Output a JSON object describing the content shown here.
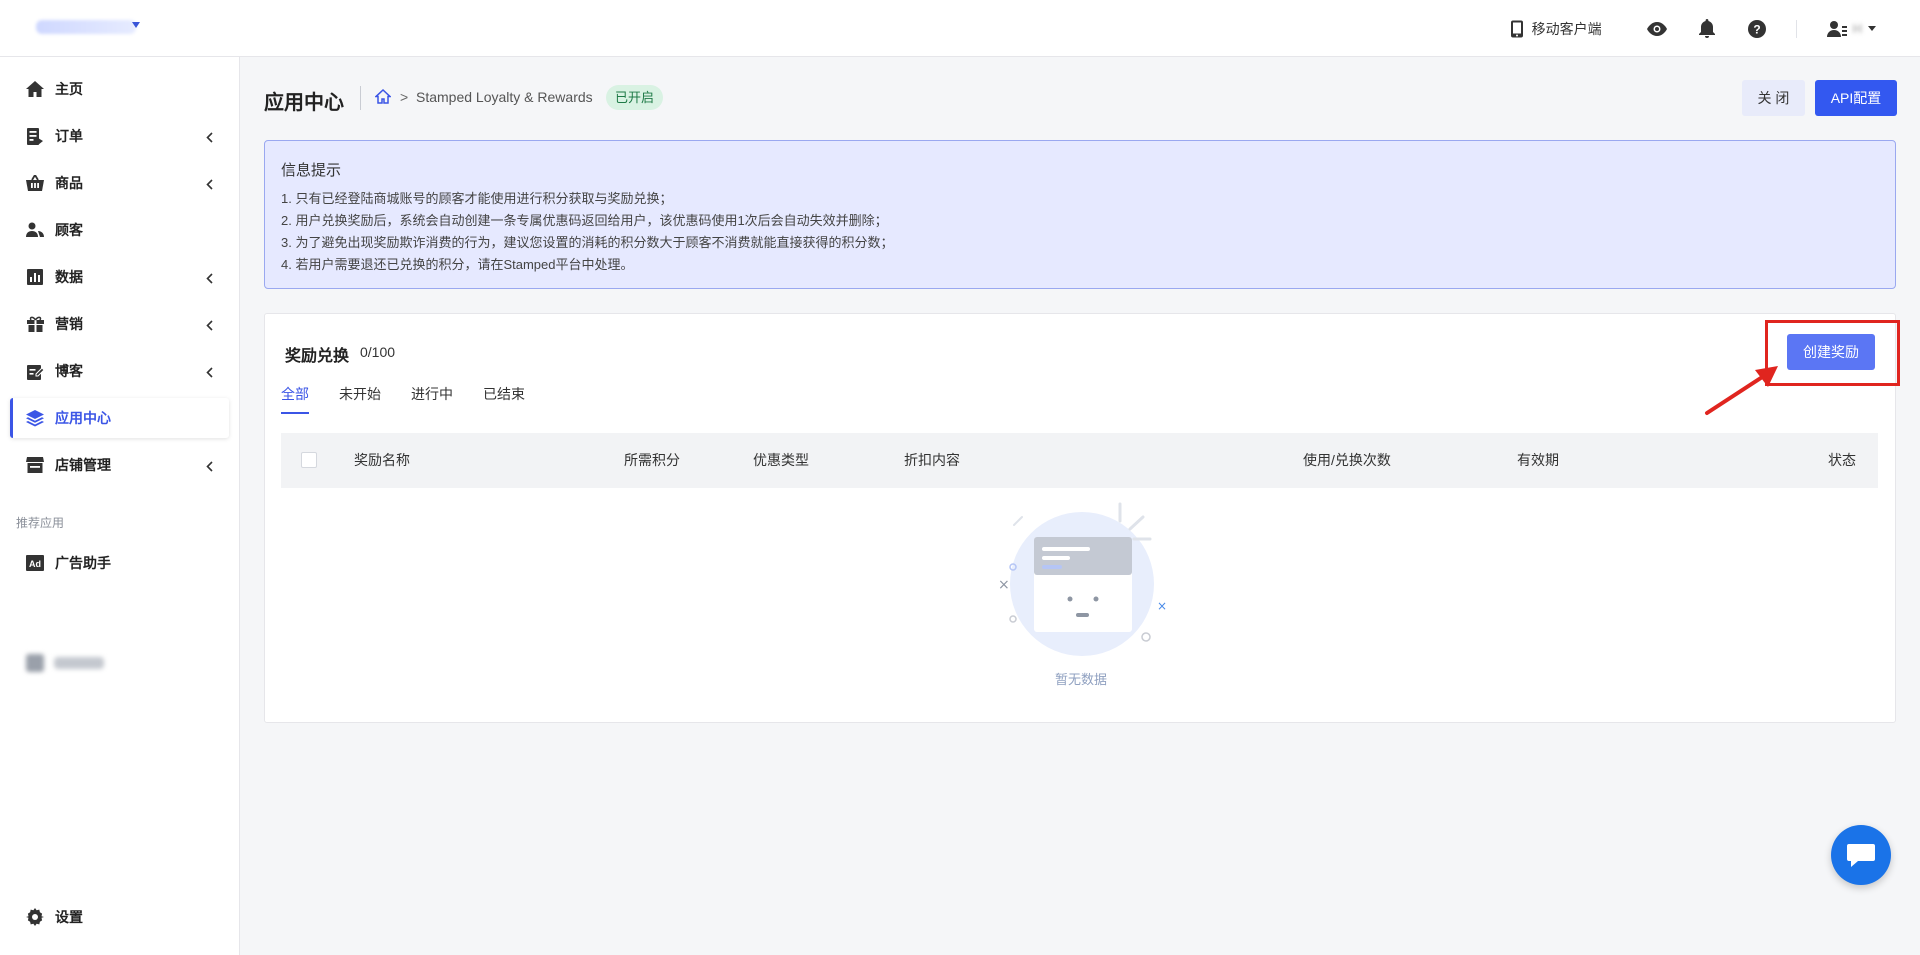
{
  "topbar": {
    "mobile_client": "移动客户端",
    "user_name": "H"
  },
  "sidebar": {
    "items": [
      {
        "label": "主页",
        "icon": "home-icon"
      },
      {
        "label": "订单",
        "icon": "order-icon"
      },
      {
        "label": "商品",
        "icon": "basket-icon"
      },
      {
        "label": "顾客",
        "icon": "customers-icon"
      },
      {
        "label": "数据",
        "icon": "chart-icon"
      },
      {
        "label": "营销",
        "icon": "gift-icon"
      },
      {
        "label": "博客",
        "icon": "edit-icon"
      },
      {
        "label": "应用中心",
        "icon": "layers-icon"
      },
      {
        "label": "店铺管理",
        "icon": "store-icon"
      }
    ],
    "recommended_label": "推荐应用",
    "recommended": [
      {
        "label": "广告助手",
        "icon": "ad-icon"
      }
    ],
    "settings_label": "设置"
  },
  "header": {
    "title": "应用中心",
    "breadcrumb_separator": ">",
    "breadcrumb_app": "Stamped Loyalty & Rewards",
    "status": "已开启",
    "close_button": "关 闭",
    "api_button": "API配置"
  },
  "info": {
    "title": "信息提示",
    "lines": [
      "1. 只有已经登陆商城账号的顾客才能使用进行积分获取与奖励兑换；",
      "2. 用户兑换奖励后，系统会自动创建一条专属优惠码返回给用户，该优惠码使用1次后会自动失效并删除；",
      "3. 为了避免出现奖励欺诈消费的行为，建议您设置的消耗的积分数大于顾客不消费就能直接获得的积分数；",
      "4. 若用户需要退还已兑换的积分，请在Stamped平台中处理。"
    ]
  },
  "rewards": {
    "title": "奖励兑换",
    "count": "0/100",
    "create_button": "创建奖励",
    "tabs": [
      "全部",
      "未开始",
      "进行中",
      "已结束"
    ],
    "columns": [
      "奖励名称",
      "所需积分",
      "优惠类型",
      "折扣内容",
      "使用/兑换次数",
      "有效期",
      "状态"
    ],
    "empty_text": "暂无数据"
  },
  "colors": {
    "primary": "#3358f0",
    "active_nav": "#3b55e6",
    "annotation": "#e0251f",
    "status_bg": "#d9f2e3"
  }
}
